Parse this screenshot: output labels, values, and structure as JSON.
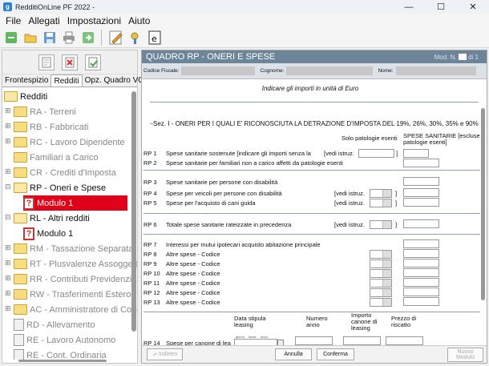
{
  "window": {
    "title": "RedditiOnLine PF 2022 -"
  },
  "menu": {
    "file": "File",
    "allegati": "Allegati",
    "impostazioni": "Impostazioni",
    "aiuto": "Aiuto"
  },
  "tabs": {
    "frontespizio": "Frontespizio",
    "redditi": "Redditi",
    "opz": "Opz. Quadro VO"
  },
  "tree": [
    {
      "label": "Redditi"
    },
    {
      "label": "RA - Terreni"
    },
    {
      "label": "RB - Fabbricati"
    },
    {
      "label": "RC - Lavoro Dipendente"
    },
    {
      "label": "Familiari a Carico"
    },
    {
      "label": "CR - Crediti d'Imposta"
    },
    {
      "label": "RP - Oneri e Spese"
    },
    {
      "label": "Modulo 1"
    },
    {
      "label": "RL - Altri redditi"
    },
    {
      "label": "Modulo 1"
    },
    {
      "label": "RM - Tassazione Separata"
    },
    {
      "label": "RT - Plusvalenze Assoggettate"
    },
    {
      "label": "RR - Contributi Previdenziali"
    },
    {
      "label": "RW - Trasferimenti Estero"
    },
    {
      "label": "AC - Amministratore di Cond"
    },
    {
      "label": "RD - Allevamento"
    },
    {
      "label": "RE - Lavoro Autonomo"
    },
    {
      "label": "RE - Cont. Ordinaria"
    }
  ],
  "quadro": {
    "title": "QUADRO RP - ONERI E SPESE",
    "mod": "Mod. N.",
    "mod_of": "di 1",
    "codice_fiscale": "Codice Fiscale:",
    "cognome": "Cognome:",
    "nome": "Nome:",
    "note": "Indicare gli importi in unità di Euro",
    "section": "Sez. I - ONERI PER I QUALI E' RICONOSCIUTA LA DETRAZIONE D'IMPOSTA DEL 19%, 26%, 30%, 35% e 90%",
    "col_patologie": "Solo patologie esenti",
    "col_spese": "SPESE SANITARIE [escluse patologie esenti]",
    "vedi": "[vedi istruz.",
    "close_bracket": "]",
    "rows": [
      {
        "code": "RP 1",
        "label": "Spese sanitarie sostenute [indicare gli importi senza la"
      },
      {
        "code": "RP 2",
        "label": "Spese sanitarie per familiari non a carico affetti da patologie esenti"
      },
      {
        "code": "RP 3",
        "label": "Spese sanitarie per persone con disabilità"
      },
      {
        "code": "RP 4",
        "label": "Spese per veicoli per persone con disabilità"
      },
      {
        "code": "RP 5",
        "label": "Spese per l'acquisto di cani guida"
      },
      {
        "code": "RP 6",
        "label": "Totale spese sanitarie rateizzate in precedenza"
      },
      {
        "code": "RP 7",
        "label": "Interessi per mutui ipotecari acquisto abitazione principale"
      },
      {
        "code": "RP 8",
        "label": "Altre spese - Codice"
      },
      {
        "code": "RP 9",
        "label": "Altre spese - Codice"
      },
      {
        "code": "RP 10",
        "label": "Altre spese - Codice"
      },
      {
        "code": "RP 11",
        "label": "Altre spese - Codice"
      },
      {
        "code": "RP 12",
        "label": "Altre spese - Codice"
      },
      {
        "code": "RP 13",
        "label": "Altre spese - Codice"
      },
      {
        "code": "RP 14",
        "label": "Spese per canone di lea"
      }
    ],
    "leasing": {
      "data": "Data stipula leasing",
      "numero": "Numero anno",
      "importo": "Importo canone di leasing",
      "prezzo": "Prezzo di riscatto",
      "giorno": "giorno",
      "mese": "mese",
      "anno": "anno"
    },
    "buttons": {
      "indietro": "Indietro",
      "annulla": "Annulla",
      "conferma": "Conferma",
      "nuovo_modulo": "Nuovo Modulo"
    }
  }
}
